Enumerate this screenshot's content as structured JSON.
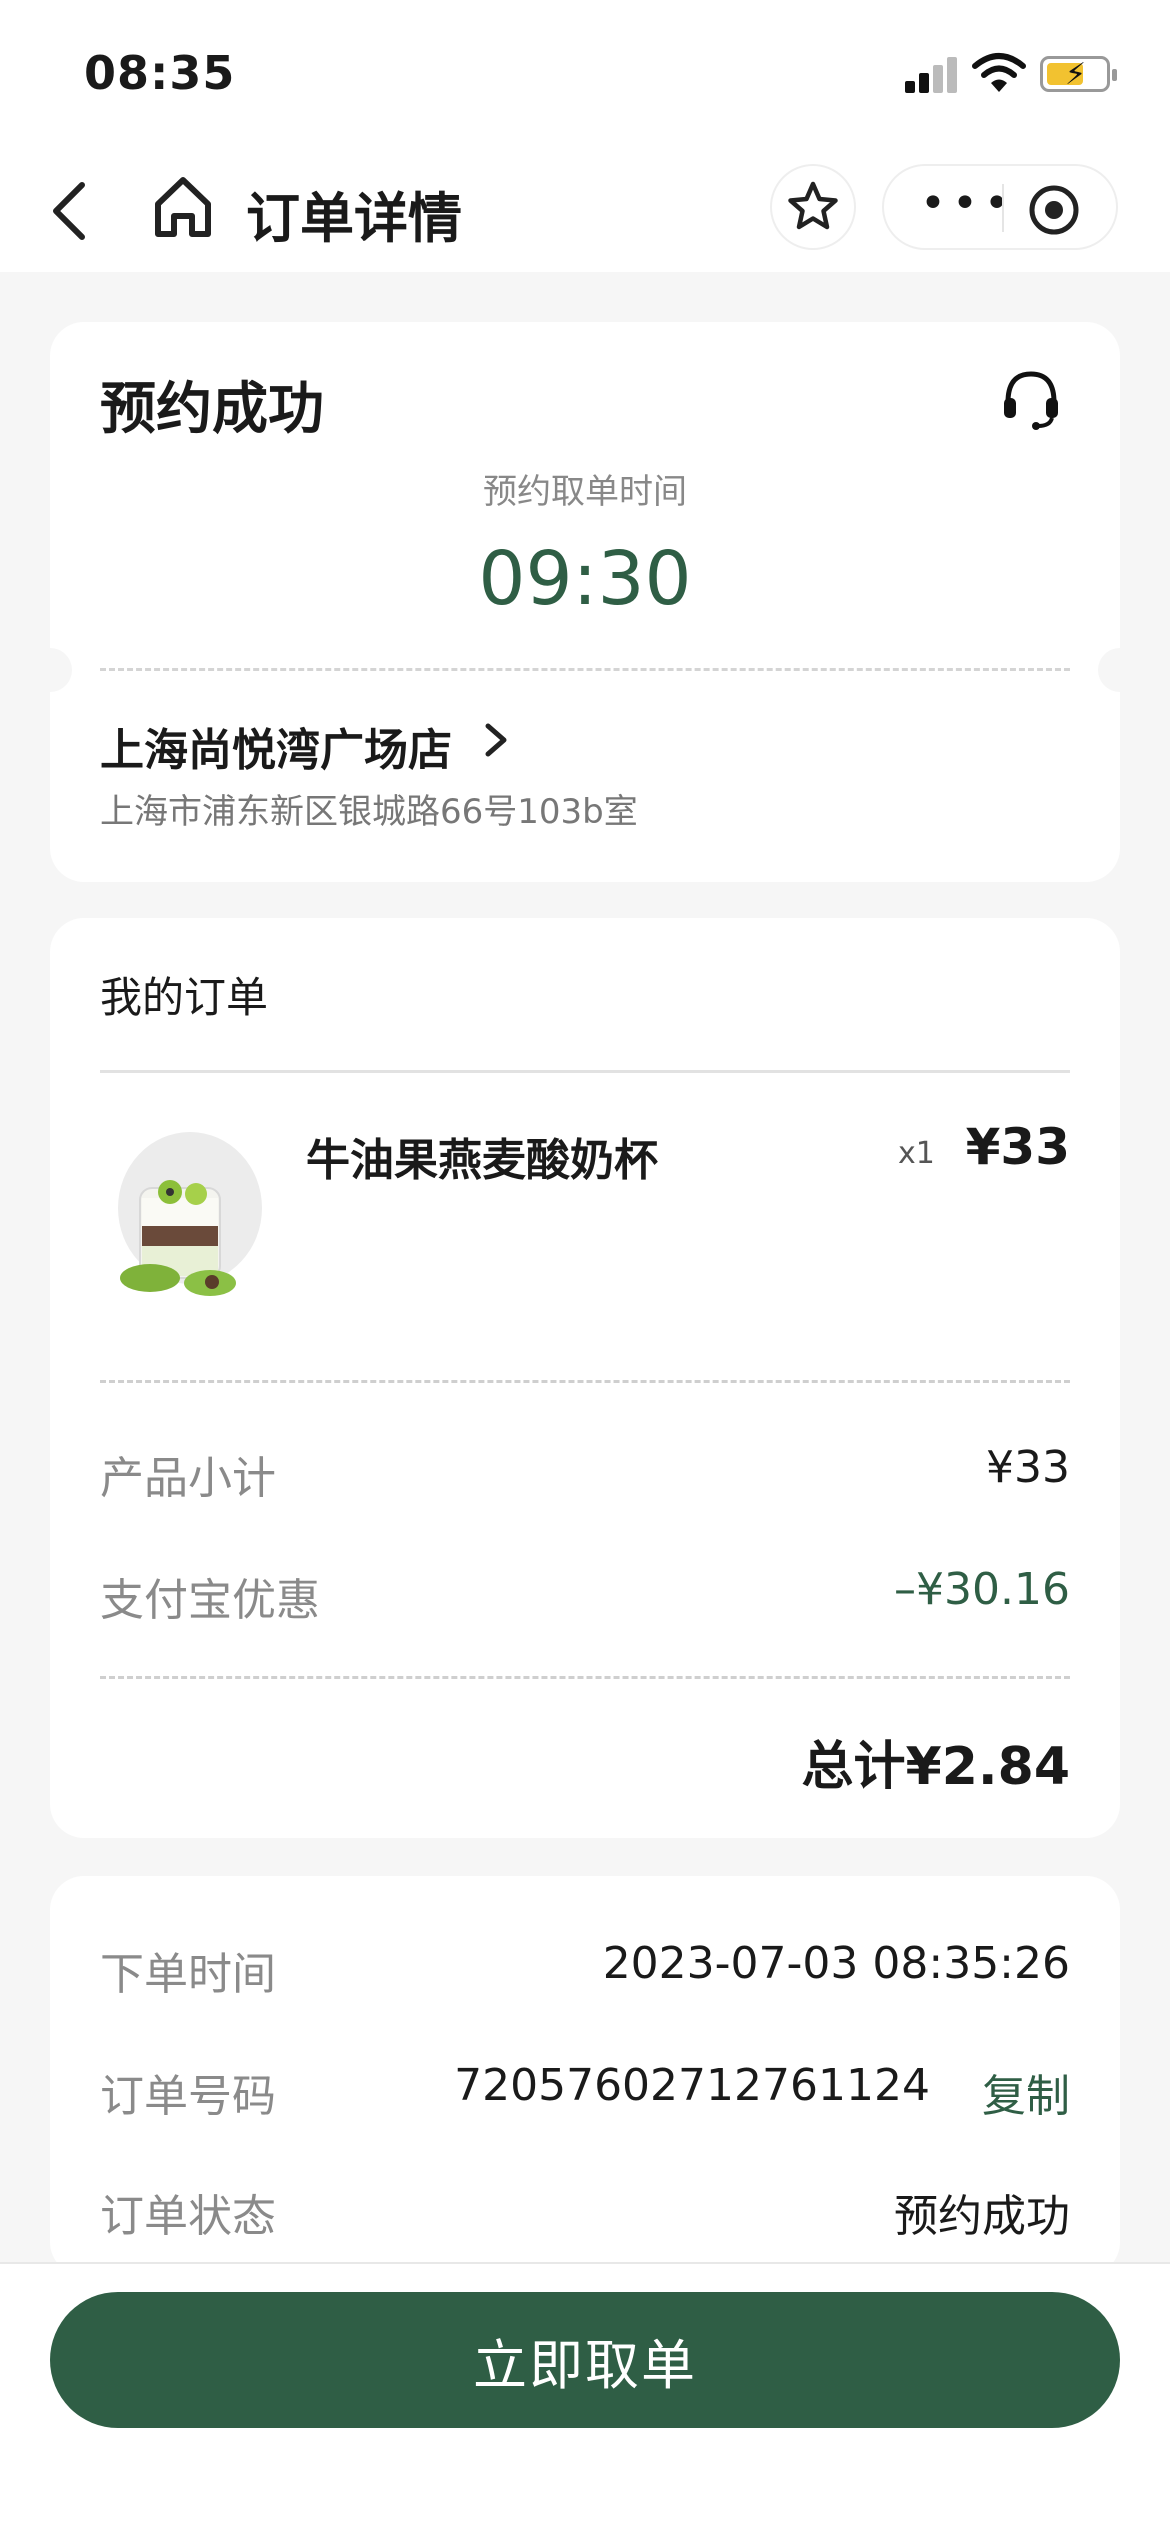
{
  "status_bar": {
    "time": "08:35"
  },
  "nav": {
    "title": "订单详情",
    "more": "•••"
  },
  "reservation": {
    "status": "预约成功",
    "pickup_label": "预约取单时间",
    "pickup_time": "09:30",
    "store_name": "上海尚悦湾广场店",
    "store_address": "上海市浦东新区银城路66号103b室"
  },
  "order": {
    "section_title": "我的订单",
    "items": [
      {
        "name": "牛油果燕麦酸奶杯",
        "qty": "x1",
        "price": "¥33",
        "image": "avocado-yogurt-cup"
      }
    ],
    "subtotal_label": "产品小计",
    "subtotal_value": "¥33",
    "discount_label": "支付宝优惠",
    "discount_value": "–¥30.16",
    "total": "总计¥2.84"
  },
  "info": {
    "order_time_label": "下单时间",
    "order_time_value": "2023-07-03 08:35:26",
    "order_no_label": "订单号码",
    "order_no_value": "72057602712761124",
    "copy_label": "复制",
    "order_status_label": "订单状态",
    "order_status_value": "预约成功"
  },
  "cta": {
    "label": "立即取单"
  },
  "colors": {
    "brand_green": "#2f5e45",
    "background": "#f6f6f6"
  }
}
